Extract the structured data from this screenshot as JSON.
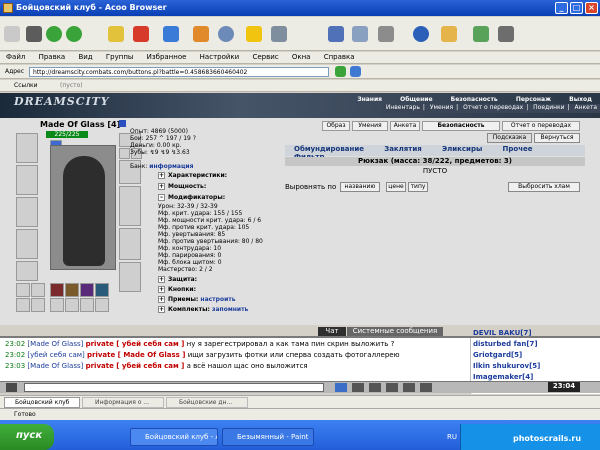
{
  "window": {
    "title": "Бойцовский клуб - Acoo Browser"
  },
  "menu": [
    "Файл",
    "Правка",
    "Вид",
    "Группы",
    "Избранное",
    "Настройки",
    "Сервис",
    "Окна",
    "Справка"
  ],
  "address": {
    "label": "Адрес",
    "url": "http://dreamscity.combats.com/buttons.pl?battle=0.458683660460402"
  },
  "links": {
    "label": "Ссылки",
    "empty": "(пусто)"
  },
  "game": {
    "logo": "DREAMSCITY",
    "nav": [
      "Знания",
      "Общение",
      "Безопасность",
      "Персонаж",
      "Выход"
    ],
    "nav2": [
      "Инвентарь",
      "Умения",
      "Отчет о переводах",
      "Поединки",
      "Анкета"
    ],
    "player": "Made Of Glass [4]",
    "hp": "225/225",
    "stats": [
      "Опыт: 4869 (5000)",
      "Бои: 257 ^ 197 / 19 ?",
      "Деньги: 0.00 кр.",
      "Зубы: ↯9 ↯9 ↯3.63"
    ],
    "bank_label": "Банк:",
    "bank_link": "информация",
    "sections": [
      "Характеристики:",
      "Мощность:",
      "Модификаторы:",
      "Защита:",
      "Кнопки:",
      "Приемы:",
      "Комплекты:"
    ],
    "mods": [
      "Урон: 32-39 / 32-39",
      "Мф. крит. удара: 155 / 155",
      "Мф. мощности крит. удара: 6 / 6",
      "Мф. против крит. удара: 105",
      "Мф. увертывания: 85",
      "Мф. против увертывания: 80 / 80",
      "Мф. контрудара: 10",
      "Мф. парирования: 0",
      "Мф. блока щитом: 0",
      "Мастерство: 2 / 2"
    ],
    "priem_link": "настроить",
    "komplekt_link": "запомнить",
    "top_buttons": [
      "Образ",
      "Умения",
      "Анкета",
      "Безопасность",
      "Отчет о переводах"
    ],
    "hint_btn": "Подсказка",
    "return_btn": "Вернуться",
    "inv_tabs": [
      "Обмундирование",
      "Заклятия",
      "Эликсиры",
      "Прочее",
      "Фильтр"
    ],
    "backpack": "Рюкзак (масса: 38/222, предметов: 3)",
    "empty": "ПУСТО",
    "sort_label": "Выровнять по",
    "sort_options": [
      "названию",
      "цене",
      "типу"
    ],
    "drop_btn": "Выбросить хлам"
  },
  "chat": {
    "tabs": [
      "Чат",
      "Системные сообщения"
    ],
    "lines": [
      {
        "time": "23:02",
        "from": "[Made Of Glass]",
        "to": "private [ убей себя сам ]",
        "text": "ну я зарегестрировал а как тама пин скрин выложить ?"
      },
      {
        "time": "23:02",
        "from": "[убей себя сам]",
        "to": "private [ Made Of Glass ]",
        "text": "ищи загрузить фотки или сперва создать фотогаллерею"
      },
      {
        "time": "23:03",
        "from": "[Made Of Glass]",
        "to": "private [ убей себя сам ]",
        "text": "а всё нашол щас оно выложится"
      }
    ],
    "users": [
      "DEVIL BAKU[7]",
      "disturbed fan[7]",
      "Griotgard[5]",
      "Ilkin shukurov[5]",
      "Imagemaker[4]"
    ],
    "clock": "23:04"
  },
  "tabs": [
    "Бойцовский клуб",
    "Информация о ...",
    "Бойцовские дн..."
  ],
  "status": "Готово",
  "taskbar": {
    "start": "пуск",
    "tasks": [
      "Бойцовский клуб - A...",
      "Безымянный - Paint"
    ],
    "lang": "RU",
    "tray_time": "photoscrails.ru"
  }
}
